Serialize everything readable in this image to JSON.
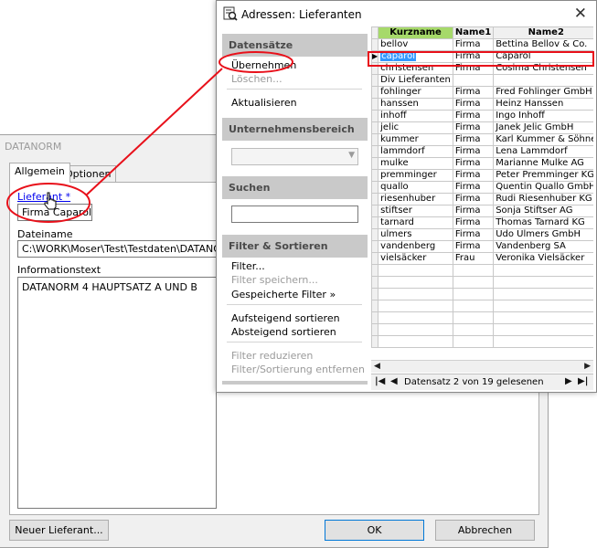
{
  "background_dialog": {
    "title": "DATANORM",
    "tabs": [
      "Allgemein",
      "Optionen"
    ],
    "lieferant_label": "Lieferant *",
    "lieferant_value": "Firma Caparol",
    "dateiname_label": "Dateiname",
    "dateiname_value": "C:\\WORK\\Moser\\Test\\Testdaten\\DATANORM\\S",
    "informationstext_label": "Informationstext",
    "informationstext_value": "DATANORM 4 HAUPTSATZ A UND B",
    "buttons": {
      "new": "Neuer Lieferant...",
      "ok": "OK",
      "cancel": "Abbrechen"
    }
  },
  "address_dialog": {
    "title": "Adressen: Lieferanten",
    "close_icon": "close-icon",
    "sections": {
      "datensaetze": {
        "header": "Datensätze",
        "items": [
          "Übernehmen",
          "Löschen...",
          "Aktualisieren"
        ]
      },
      "unternehmensbereich": {
        "header": "Unternehmensbereich",
        "selected": ""
      },
      "suchen": {
        "header": "Suchen",
        "value": ""
      },
      "filter": {
        "header": "Filter & Sortieren",
        "items": [
          "Filter...",
          "Filter speichern...",
          "Gespeicherte Filter »",
          "Aufsteigend sortieren",
          "Absteigend sortieren",
          "Filter reduzieren",
          "Filter/Sortierung entfernen"
        ]
      }
    },
    "grid": {
      "columns": [
        "Kurzname",
        "Name1",
        "Name2"
      ],
      "rows": [
        [
          "bellov",
          "Firma",
          "Bettina Bellov & Co."
        ],
        [
          "caparol",
          "Firma",
          "Caparol"
        ],
        [
          "christensen",
          "Firma",
          "Cosima Christensen"
        ],
        [
          "Div Lieferanten",
          "",
          ""
        ],
        [
          "fohlinger",
          "Firma",
          "Fred Fohlinger GmbH"
        ],
        [
          "hanssen",
          "Firma",
          "Heinz Hanssen"
        ],
        [
          "inhoff",
          "Firma",
          "Ingo Inhoff"
        ],
        [
          "jelic",
          "Firma",
          "Janek Jelic GmbH"
        ],
        [
          "kummer",
          "Firma",
          "Karl Kummer & Söhne"
        ],
        [
          "lammdorf",
          "Firma",
          "Lena Lammdorf"
        ],
        [
          "mulke",
          "Firma",
          "Marianne Mulke AG"
        ],
        [
          "premminger",
          "Firma",
          "Peter Premminger KG"
        ],
        [
          "quallo",
          "Firma",
          "Quentin Quallo GmbH"
        ],
        [
          "riesenhuber",
          "Firma",
          "Rudi Riesenhuber KG"
        ],
        [
          "stiftser",
          "Firma",
          "Sonja Stiftser AG"
        ],
        [
          "tarnard",
          "Firma",
          "Thomas Tarnard KG"
        ],
        [
          "ulmers",
          "Firma",
          "Udo Ulmers GmbH"
        ],
        [
          "vandenberg",
          "Firma",
          "Vandenberg SA"
        ],
        [
          "vielsäcker",
          "Frau",
          "Veronika Vielsäcker"
        ]
      ],
      "selected_row": 1,
      "empty_rows": 7
    },
    "status": "Datensatz 2 von 19 gelesenen"
  },
  "colors": {
    "sorted_header": "#a6d96a",
    "selection": "#3399ff",
    "annotation": "#e8101a",
    "link": "#0000ee"
  }
}
